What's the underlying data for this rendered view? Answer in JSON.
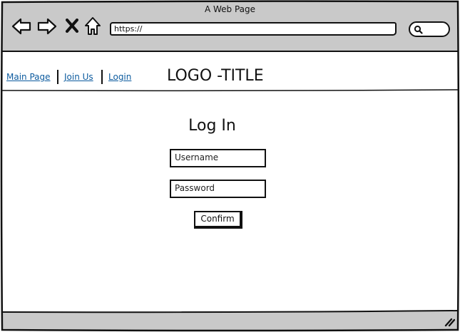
{
  "browser": {
    "title": "A Web Page",
    "address_bar": {
      "value": "https://"
    },
    "icons": [
      "back-arrow-icon",
      "forward-arrow-icon",
      "stop-x-icon",
      "home-icon",
      "search-icon",
      "resize-grip-icon"
    ]
  },
  "nav": {
    "links": [
      {
        "label": "Main Page"
      },
      {
        "label": "Join Us"
      },
      {
        "label": "Login"
      }
    ],
    "logo_title": "LOGO -TITLE"
  },
  "login": {
    "heading": "Log In",
    "username_placeholder": "Username",
    "password_placeholder": "Password",
    "confirm_label": "Confirm"
  },
  "colors": {
    "chrome_gray": "#c9c9c9",
    "link_blue": "#0b5a9e",
    "ink": "#111111"
  }
}
